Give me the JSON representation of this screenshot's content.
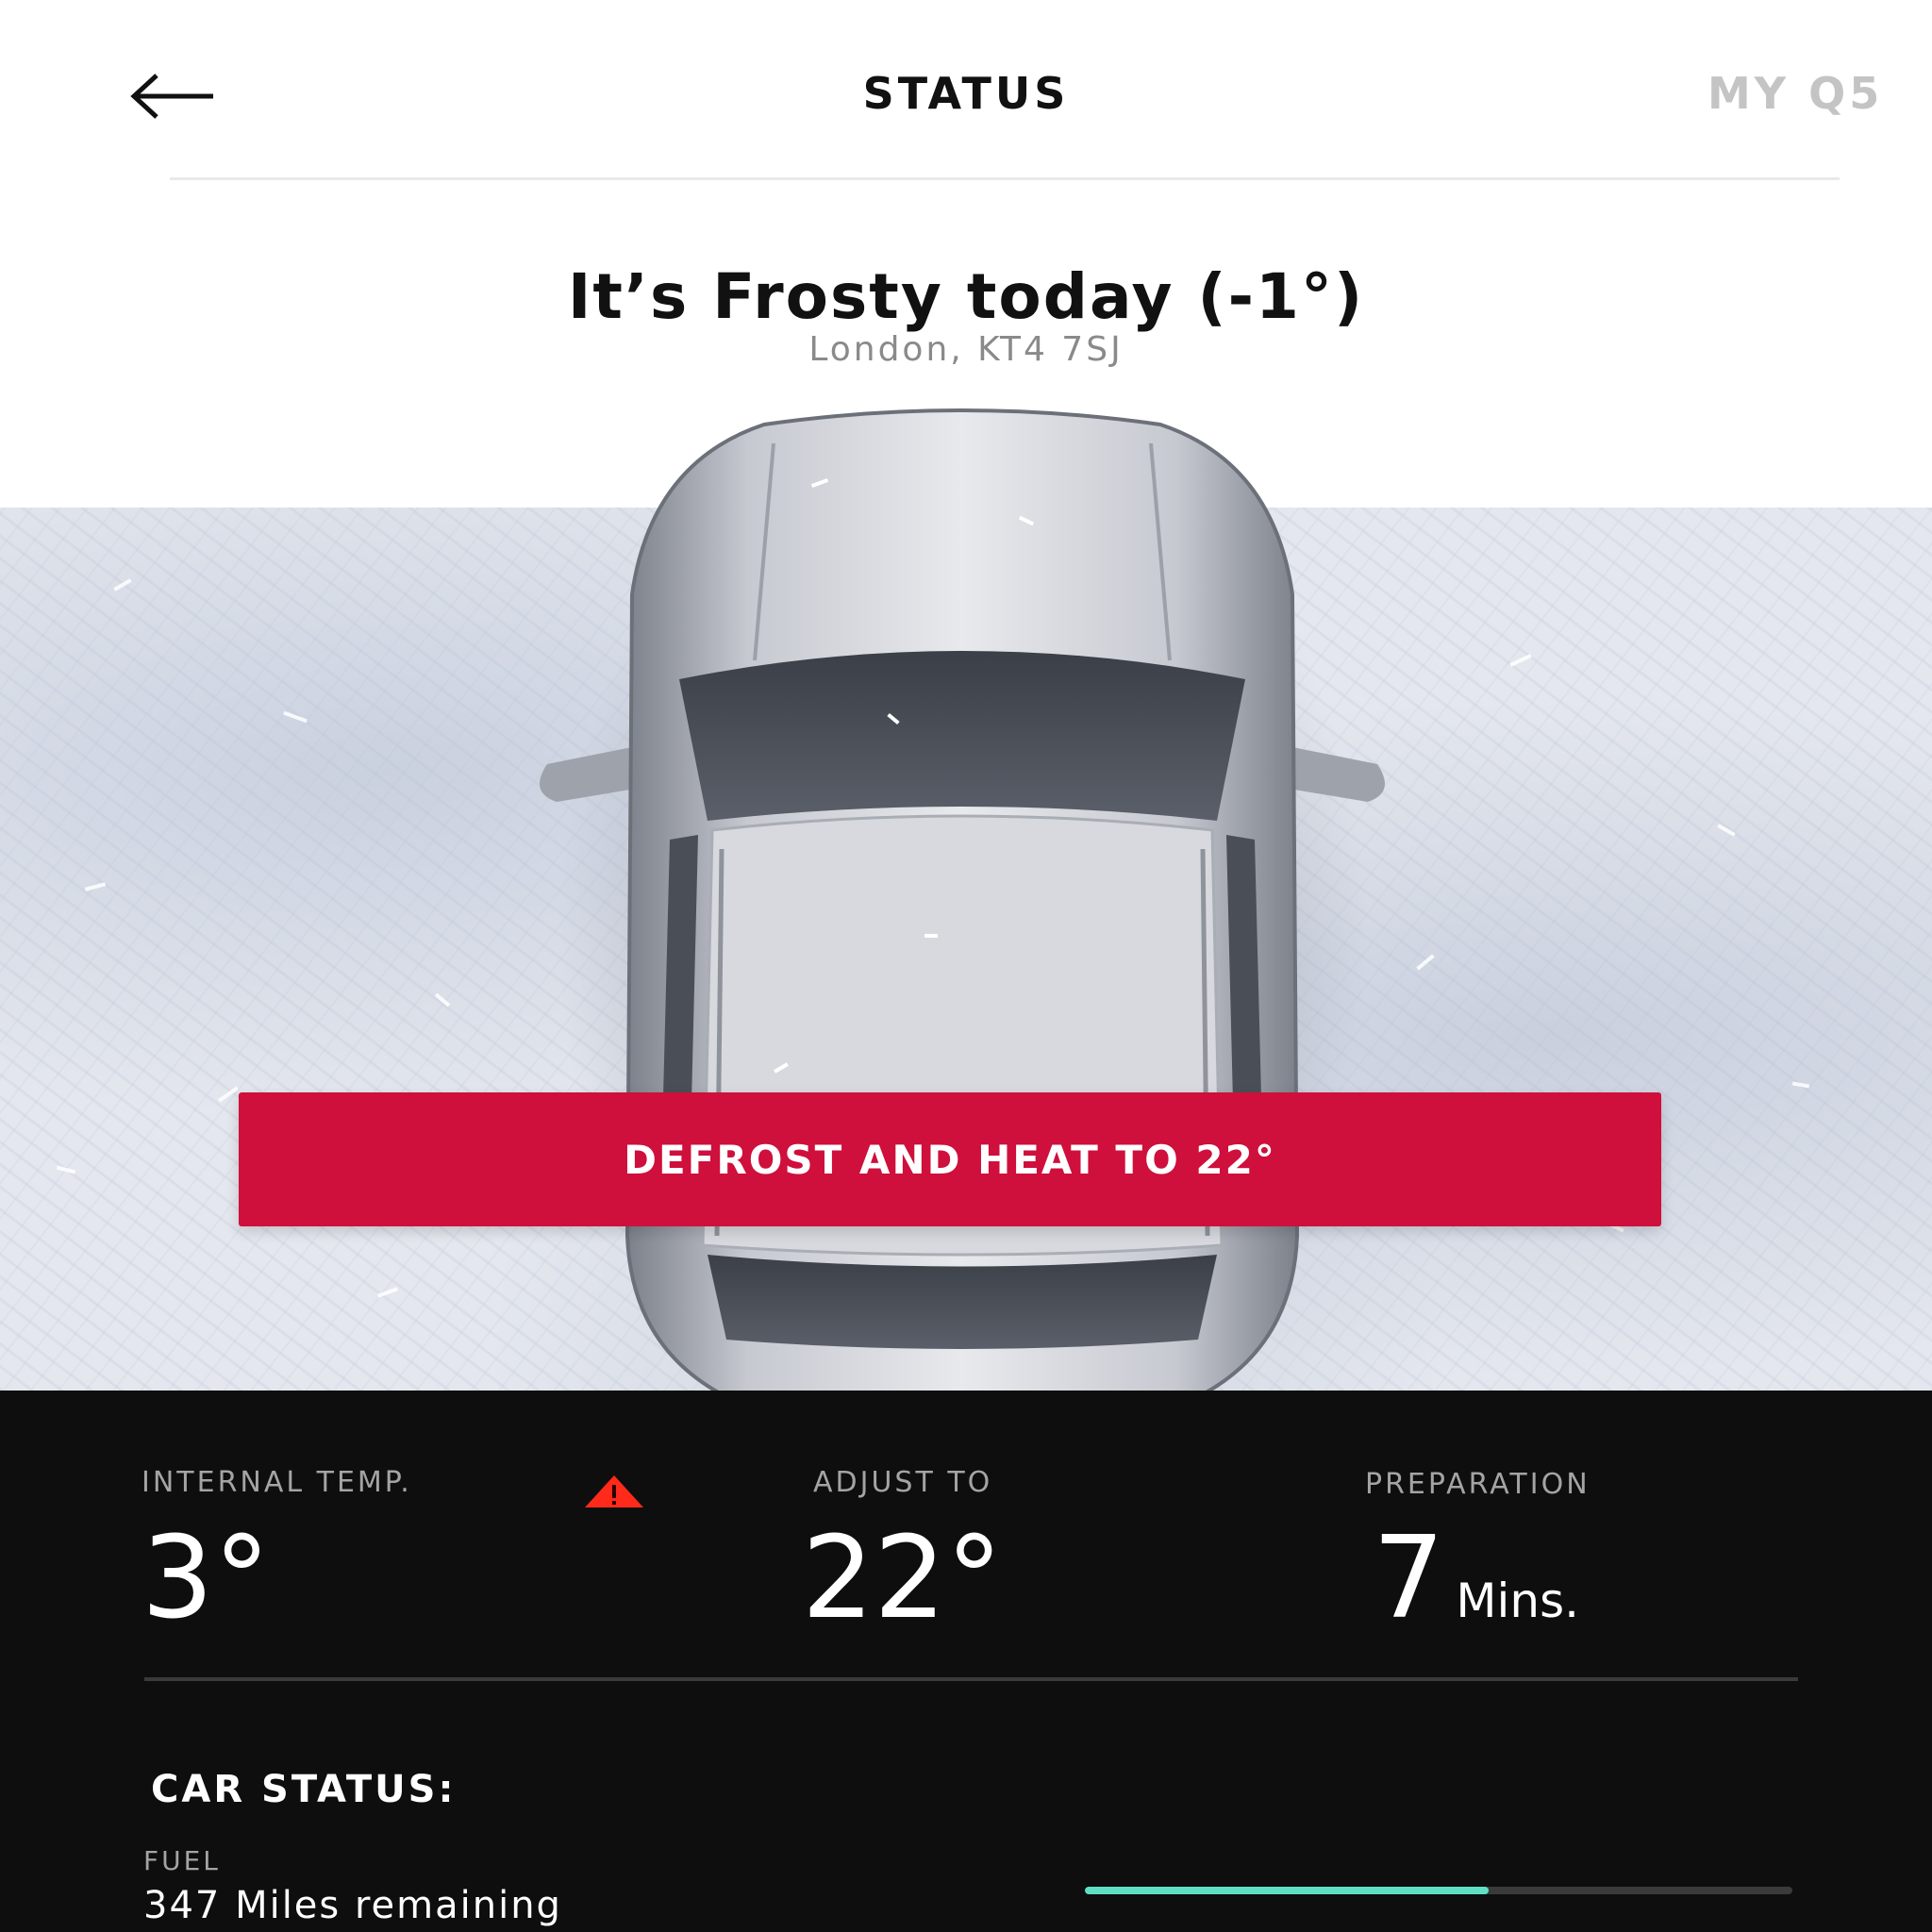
{
  "nav": {
    "title": "STATUS",
    "next_tab": "MY Q5",
    "back_icon": "arrow-left-icon"
  },
  "weather": {
    "headline": "It’s Frosty today (-1°)",
    "location": "London, KT4 7SJ"
  },
  "action": {
    "label": "DEFROST AND HEAT TO 22°",
    "color": "#cf0f3c"
  },
  "stats": {
    "internal_temp": {
      "label": "INTERNAL TEMP.",
      "value": "3°",
      "warning_icon": "warning-triangle-icon",
      "warning_color": "#ff2a1a"
    },
    "adjust_to": {
      "label": "ADJUST TO",
      "value": "22°"
    },
    "preparation": {
      "label": "PREPARATION",
      "value": "7",
      "unit": "Mins."
    }
  },
  "car_status": {
    "title": "CAR STATUS:",
    "fuel": {
      "label": "FUEL",
      "value": "347 Miles remaining",
      "level": 0.57,
      "bar_color": "#5fe0c4"
    }
  }
}
